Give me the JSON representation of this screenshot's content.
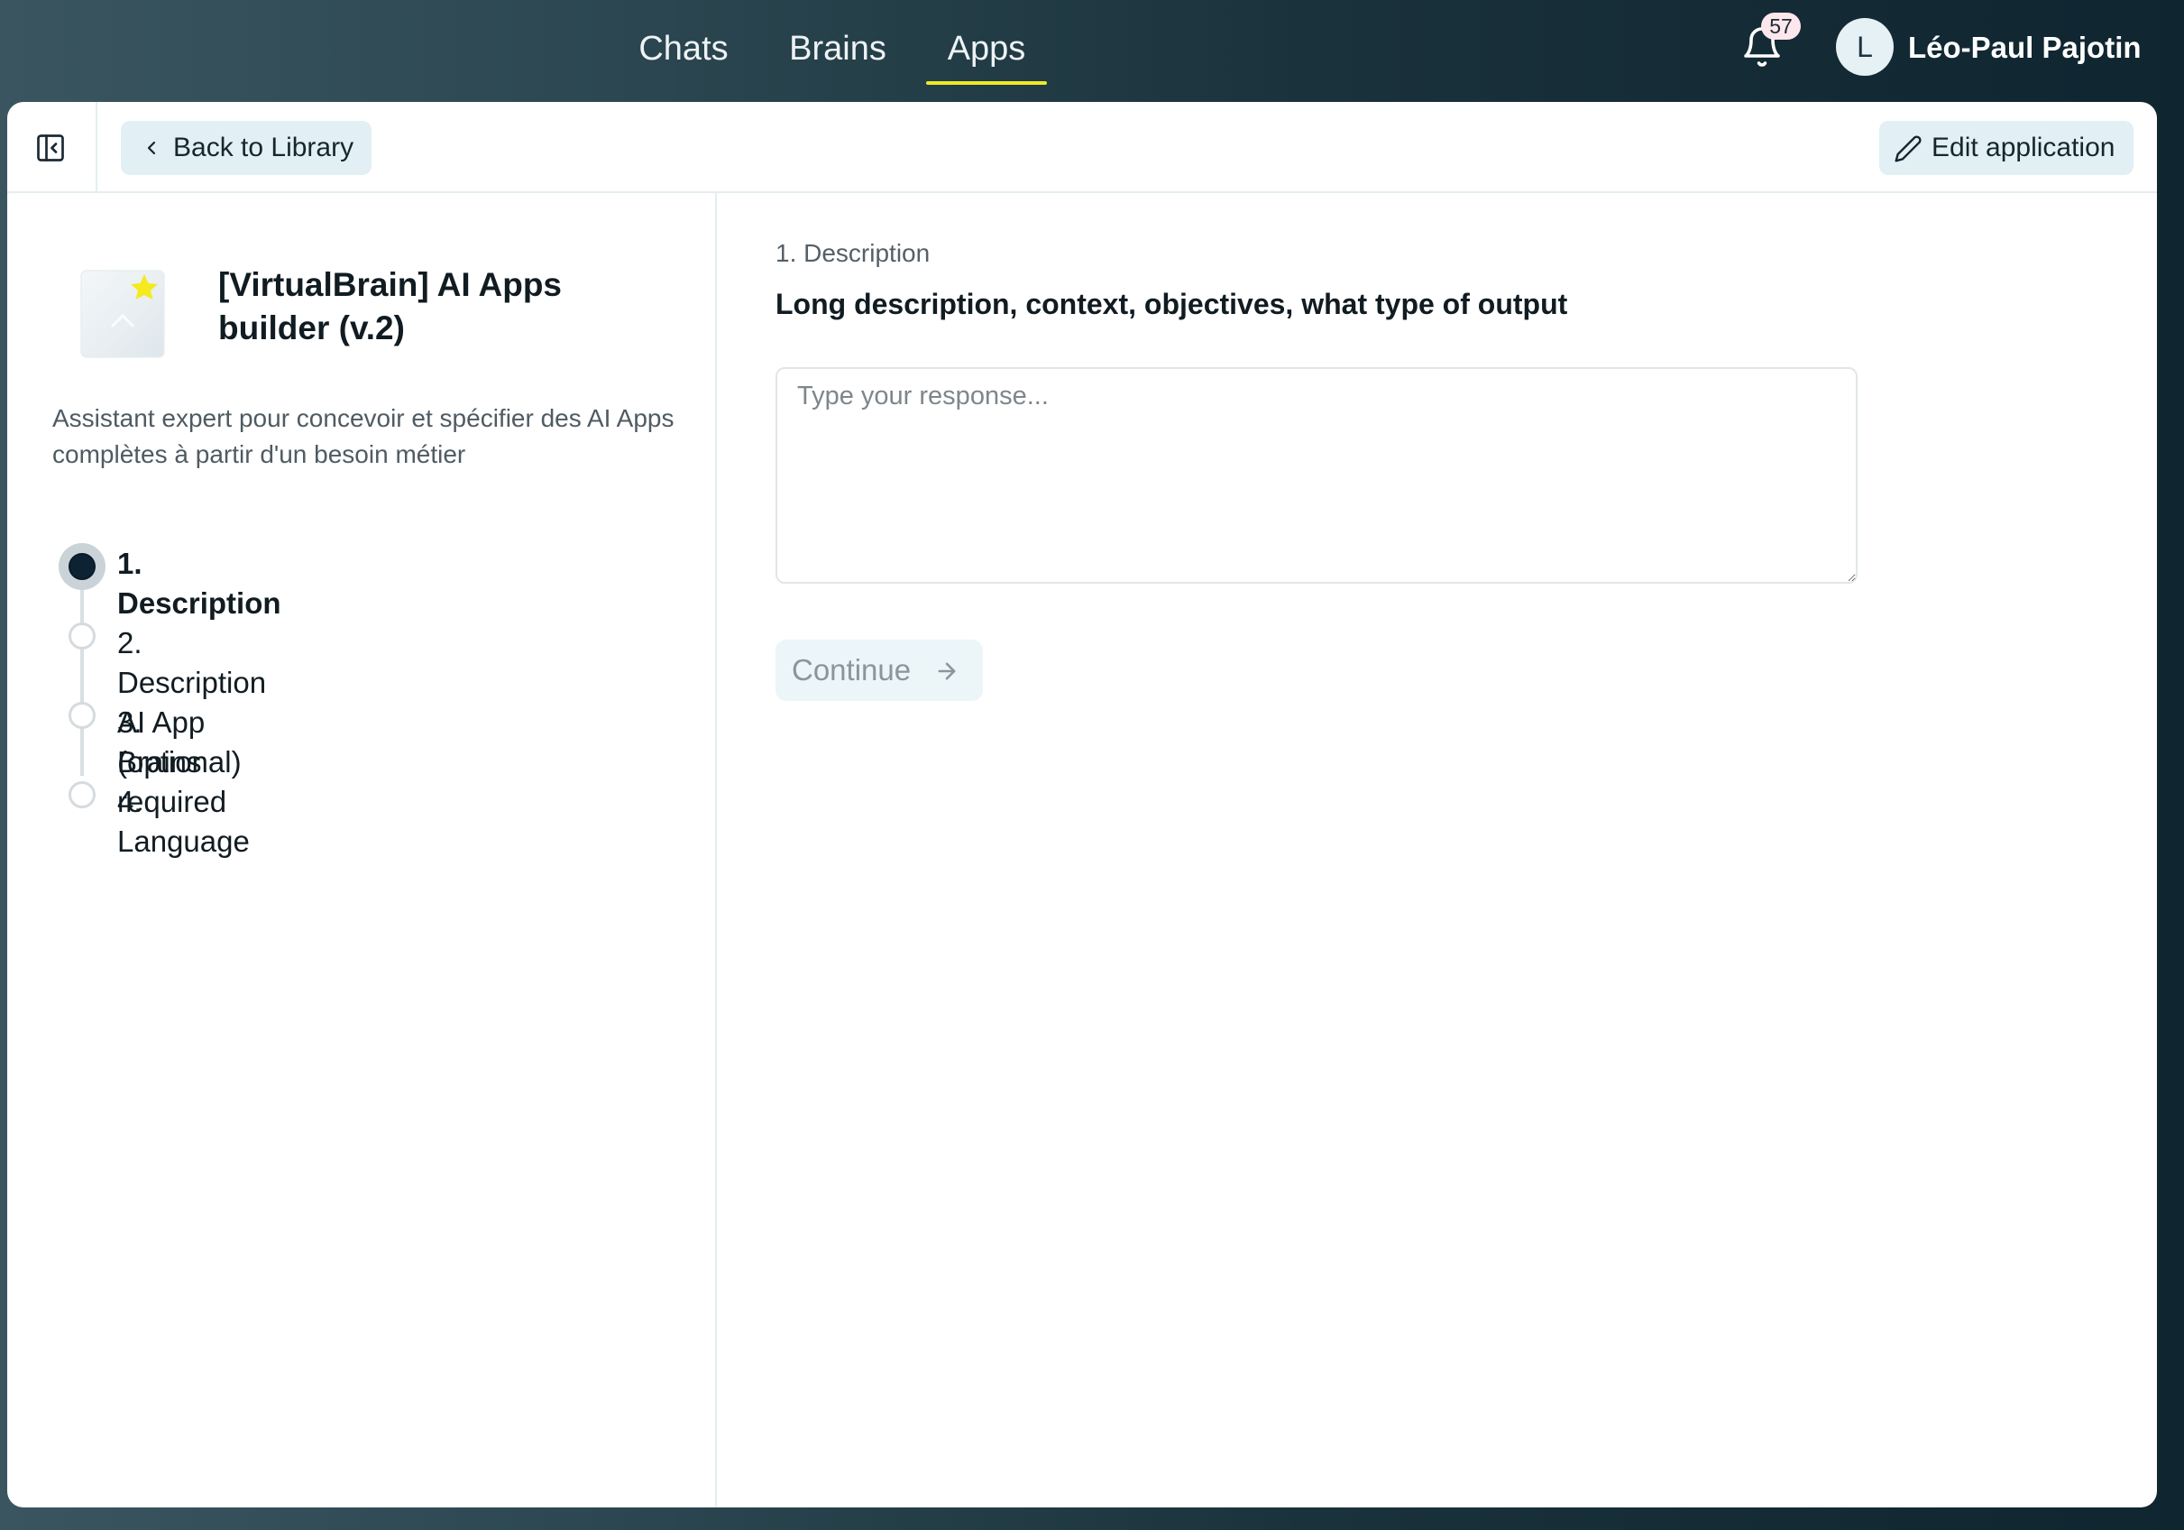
{
  "nav": {
    "tabs": [
      {
        "label": "Chats"
      },
      {
        "label": "Brains"
      },
      {
        "label": "Apps"
      }
    ],
    "notifications_count": "57",
    "user": {
      "initial": "L",
      "name": "Léo-Paul Pajotin"
    }
  },
  "header": {
    "back_label": "Back to Library",
    "edit_label": "Edit application"
  },
  "app": {
    "title": "[VirtualBrain] AI Apps builder (v.2)",
    "description": "Assistant expert pour concevoir et spécifier des AI Apps complètes à partir d'un besoin métier",
    "steps": [
      {
        "label": "1. Description",
        "state": "active"
      },
      {
        "label": "2. Description AI App (optional)",
        "state": "pending"
      },
      {
        "label": "3. Brains required",
        "state": "pending"
      },
      {
        "label": "4. Language",
        "state": "pending"
      }
    ]
  },
  "question": {
    "kicker": "1. Description",
    "title": "Long description, context, objectives, what type of output",
    "placeholder": "Type your response...",
    "value": "",
    "continue_label": "Continue"
  },
  "colors": {
    "accent_underline": "#ecea28",
    "button_bg": "#e2f0f5",
    "active_step": "#0d2233"
  }
}
